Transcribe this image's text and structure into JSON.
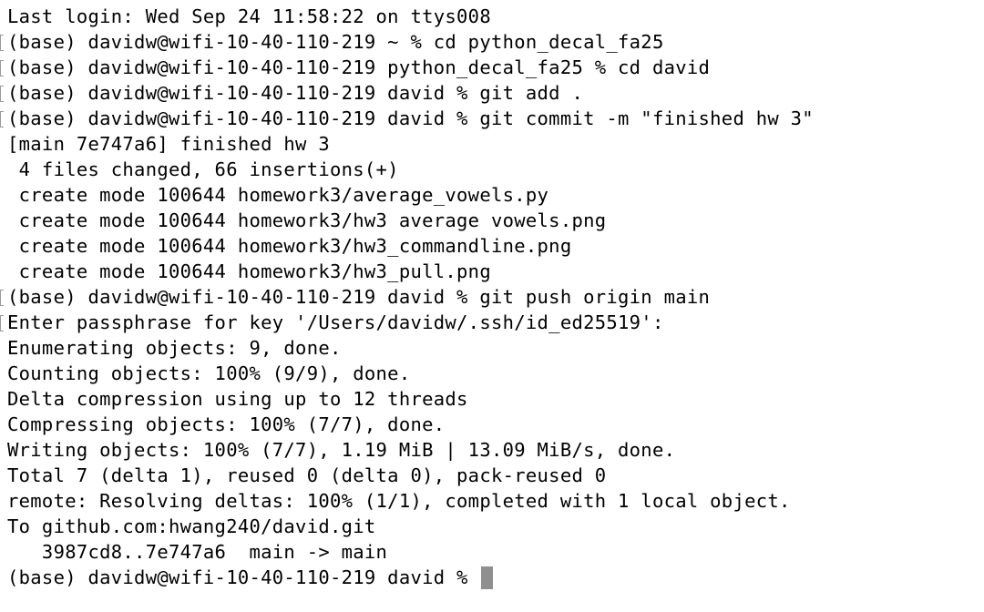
{
  "terminal": {
    "lines": [
      {
        "text": "Last login: Wed Sep 24 11:58:22 on ttys008",
        "marked": false
      },
      {
        "text": "(base) davidw@wifi-10-40-110-219 ~ % cd python_decal_fa25",
        "marked": true
      },
      {
        "text": "(base) davidw@wifi-10-40-110-219 python_decal_fa25 % cd david",
        "marked": true
      },
      {
        "text": "(base) davidw@wifi-10-40-110-219 david % git add .",
        "marked": true
      },
      {
        "text": "(base) davidw@wifi-10-40-110-219 david % git commit -m \"finished hw 3\"",
        "marked": true
      },
      {
        "text": "[main 7e747a6] finished hw 3",
        "marked": false
      },
      {
        "text": " 4 files changed, 66 insertions(+)",
        "marked": false
      },
      {
        "text": " create mode 100644 homework3/average_vowels.py",
        "marked": false
      },
      {
        "text": " create mode 100644 homework3/hw3 average vowels.png",
        "marked": false
      },
      {
        "text": " create mode 100644 homework3/hw3_commandline.png",
        "marked": false
      },
      {
        "text": " create mode 100644 homework3/hw3_pull.png",
        "marked": false
      },
      {
        "text": "(base) davidw@wifi-10-40-110-219 david % git push origin main",
        "marked": true
      },
      {
        "text": "Enter passphrase for key '/Users/davidw/.ssh/id_ed25519':",
        "marked": true
      },
      {
        "text": "Enumerating objects: 9, done.",
        "marked": false
      },
      {
        "text": "Counting objects: 100% (9/9), done.",
        "marked": false
      },
      {
        "text": "Delta compression using up to 12 threads",
        "marked": false
      },
      {
        "text": "Compressing objects: 100% (7/7), done.",
        "marked": false
      },
      {
        "text": "Writing objects: 100% (7/7), 1.19 MiB | 13.09 MiB/s, done.",
        "marked": false
      },
      {
        "text": "Total 7 (delta 1), reused 0 (delta 0), pack-reused 0",
        "marked": false
      },
      {
        "text": "remote: Resolving deltas: 100% (1/1), completed with 1 local object.",
        "marked": false
      },
      {
        "text": "To github.com:hwang240/david.git",
        "marked": false
      },
      {
        "text": "   3987cd8..7e747a6  main -> main",
        "marked": false
      }
    ],
    "prompt": "(base) davidw@wifi-10-40-110-219 david % ",
    "colors": {
      "background": "#ffffff",
      "text": "#000000",
      "cursor": "#8f8f8f",
      "marker": "#9a9a9a"
    }
  }
}
